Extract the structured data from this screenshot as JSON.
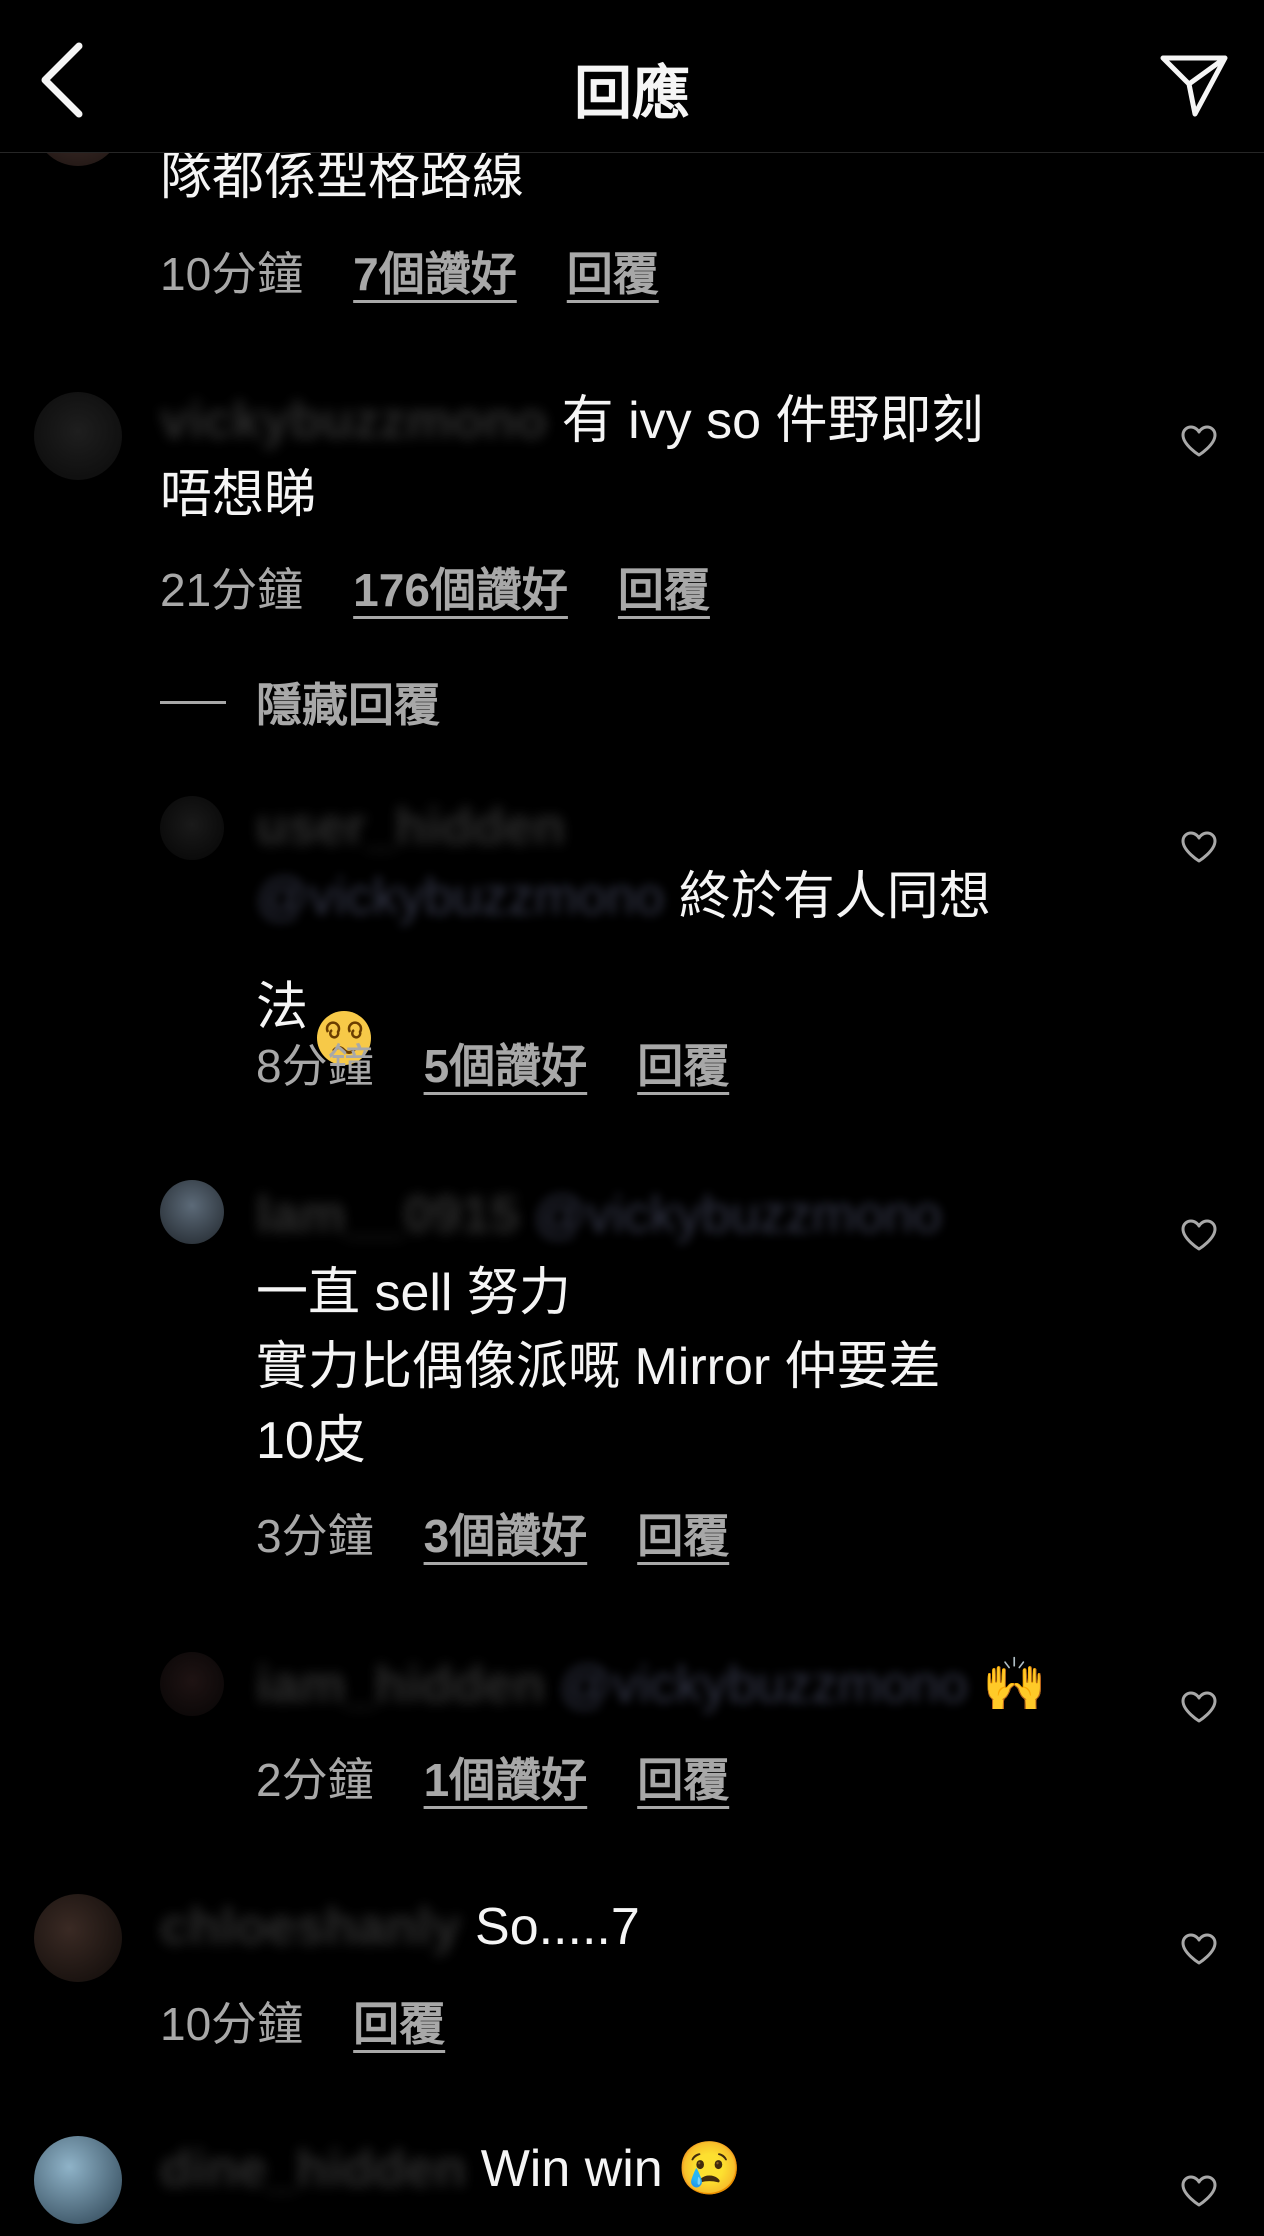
{
  "header": {
    "title": "回應"
  },
  "comments": [
    {
      "body_tail": "隊都係型格路線",
      "time": "10分鐘",
      "likes": "7個讚好",
      "reply": "回覆"
    },
    {
      "username": "vickybuzzmono",
      "text": " 有 ivy so 件野即刻\n唔想睇",
      "time": "21分鐘",
      "likes": "176個讚好",
      "reply": "回覆"
    },
    {
      "hide_replies": "隱藏回覆"
    },
    {
      "username": "user_hidden",
      "mention": "@vickybuzzmono",
      "text": " 終於有人同想\n法",
      "time": "8分鐘",
      "likes": "5個讚好",
      "reply": "回覆"
    },
    {
      "username": "lam__0915",
      "mention": "@vickybuzzmono",
      "text": "一直 sell 努力\n實力比偶像派嘅 Mirror 仲要差\n10皮",
      "time": "3分鐘",
      "likes": "3個讚好",
      "reply": "回覆"
    },
    {
      "username": "iam_hidden",
      "mention": "@vickybuzzmono",
      "text": " 🙌",
      "time": "2分鐘",
      "likes": "1個讚好",
      "reply": "回覆"
    },
    {
      "username": "chloeshanly",
      "text": " So.....7",
      "time": "10分鐘",
      "reply": "回覆"
    },
    {
      "username": "dine_hidden",
      "text": " Win win 😢"
    }
  ],
  "icons": {
    "back": "chevron-left-icon",
    "send": "paper-plane-icon",
    "like": "heart-outline-icon"
  },
  "colors": {
    "background": "#000000",
    "text": "#f5f5f5",
    "secondary": "#a8a8a8",
    "divider": "#262626"
  }
}
